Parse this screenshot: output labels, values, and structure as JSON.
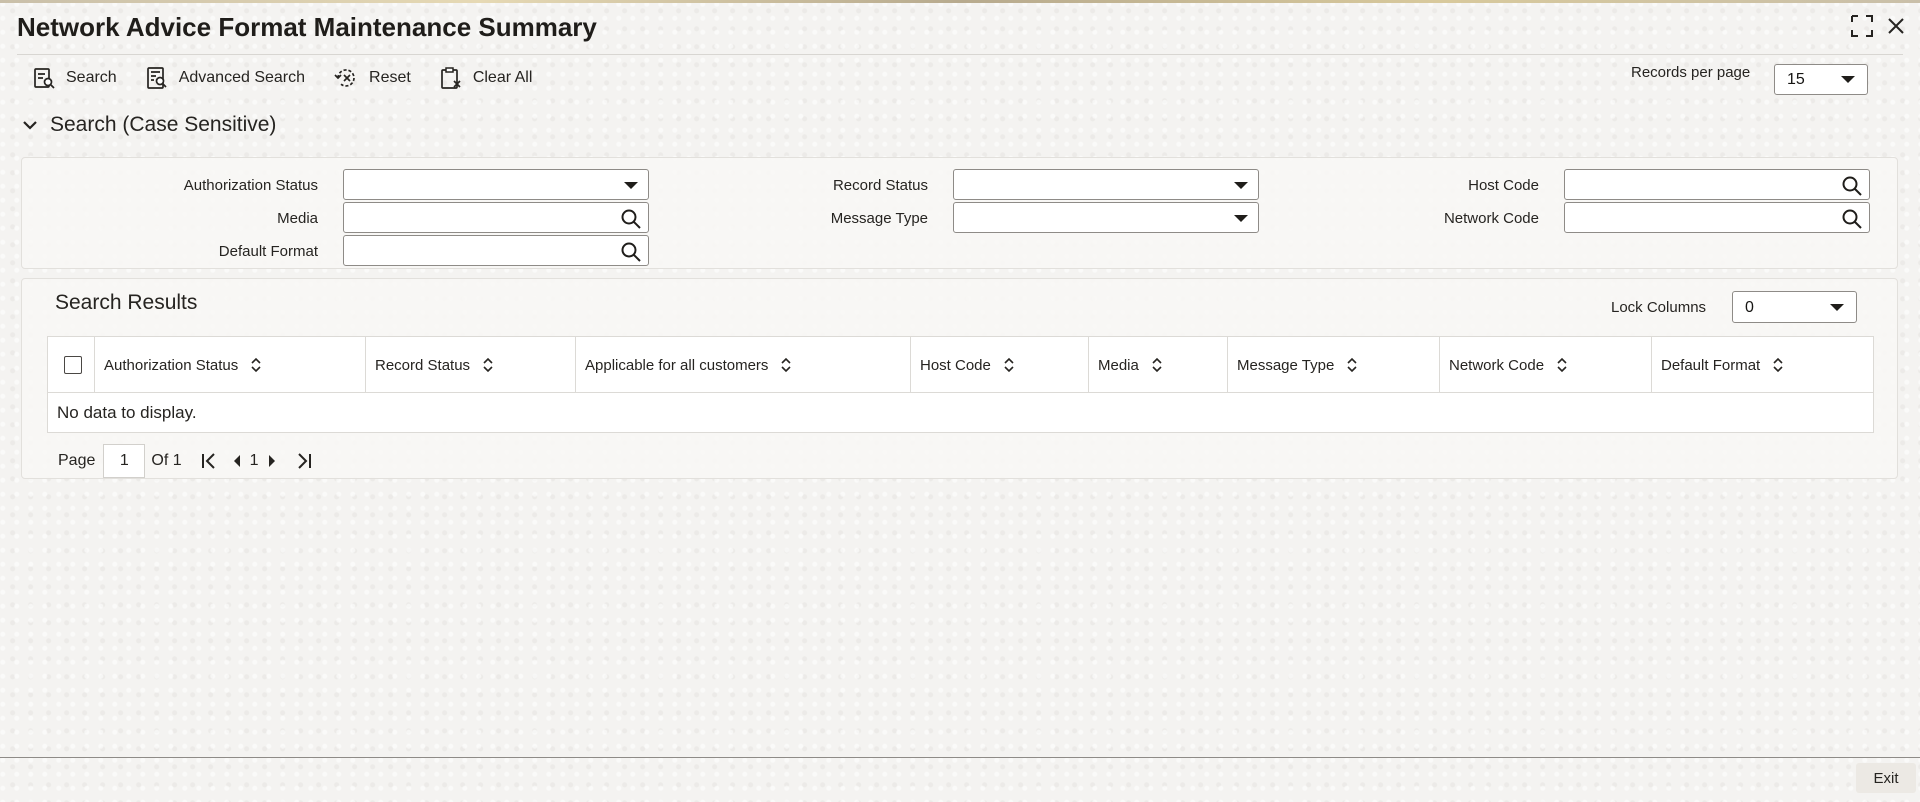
{
  "page": {
    "title": "Network Advice Format Maintenance Summary"
  },
  "toolbar": {
    "search_label": "Search",
    "advanced_search_label": "Advanced Search",
    "reset_label": "Reset",
    "clear_all_label": "Clear All"
  },
  "records_per_page": {
    "label": "Records per page",
    "value": "15"
  },
  "search_section": {
    "title": "Search (Case Sensitive)",
    "fields": {
      "authorization_status": {
        "label": "Authorization Status",
        "value": ""
      },
      "record_status": {
        "label": "Record Status",
        "value": ""
      },
      "host_code": {
        "label": "Host Code",
        "value": ""
      },
      "media": {
        "label": "Media",
        "value": ""
      },
      "message_type": {
        "label": "Message Type",
        "value": ""
      },
      "network_code": {
        "label": "Network Code",
        "value": ""
      },
      "default_format": {
        "label": "Default Format",
        "value": ""
      }
    }
  },
  "results": {
    "title": "Search Results",
    "lock_columns": {
      "label": "Lock Columns",
      "value": "0"
    },
    "columns": [
      "Authorization Status",
      "Record Status",
      "Applicable for all customers",
      "Host Code",
      "Media",
      "Message Type",
      "Network Code",
      "Default Format"
    ],
    "empty_message": "No data to display."
  },
  "pager": {
    "page_label": "Page",
    "current": "1",
    "of_label": "Of 1",
    "nav_page": "1"
  },
  "footer": {
    "exit_label": "Exit"
  },
  "icons": [
    "maximize-icon",
    "close-icon",
    "search-tool-icon",
    "advanced-search-icon",
    "reset-icon",
    "clear-all-icon",
    "chevron-down-icon",
    "magnifier-icon",
    "sort-icon",
    "first-page-icon",
    "prev-page-icon",
    "next-page-icon",
    "last-page-icon"
  ]
}
